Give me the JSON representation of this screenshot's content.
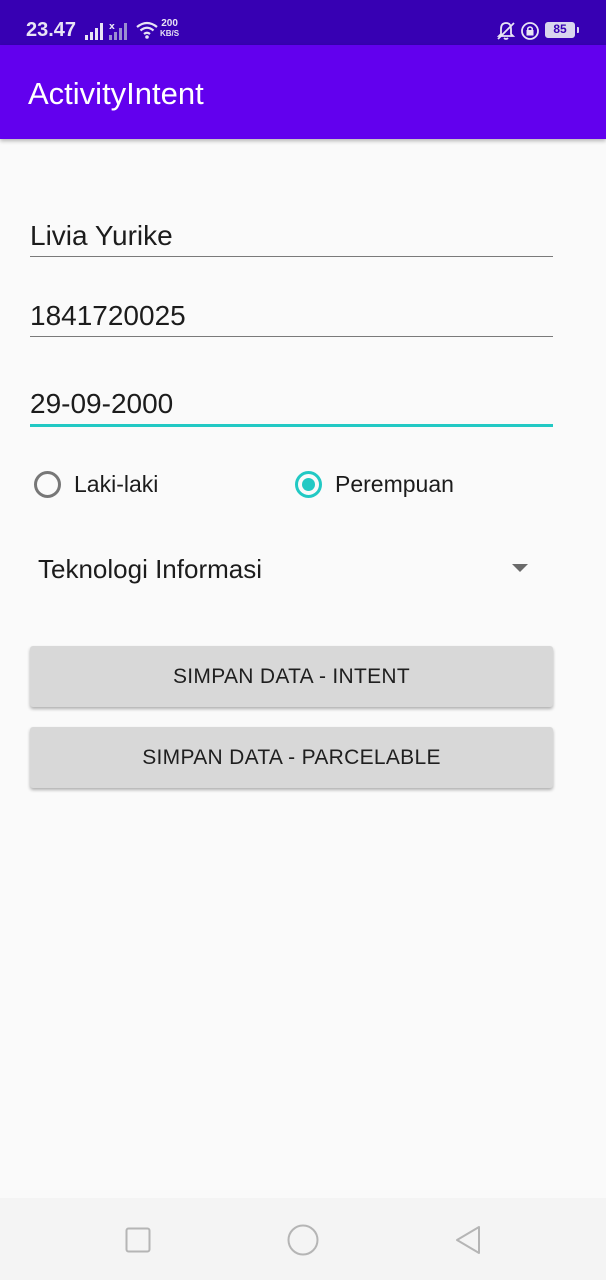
{
  "status_bar": {
    "time": "23.47",
    "net_speed_value": "200",
    "net_speed_unit": "KB/S",
    "battery": "85",
    "icons": [
      "signal-icon",
      "wifi-icon",
      "bell-off-icon",
      "lock-icon",
      "battery-icon"
    ]
  },
  "app_bar": {
    "title": "ActivityIntent"
  },
  "form": {
    "name_value": "Livia Yurike",
    "nim_value": "1841720025",
    "date_value": "29-09-2000",
    "gender_options": [
      {
        "label": "Laki-laki",
        "checked": false
      },
      {
        "label": "Perempuan",
        "checked": true
      }
    ],
    "program_selected": "Teknologi Informasi"
  },
  "buttons": {
    "save_intent": "SIMPAN DATA - INTENT",
    "save_parcelable": "SIMPAN DATA - PARCELABLE"
  },
  "nav_bar": {
    "icons": [
      "recent-apps-icon",
      "home-icon",
      "back-icon"
    ]
  },
  "colors": {
    "status_bar": "#3700b3",
    "app_bar": "#6200ee",
    "accent": "#22c9c4",
    "button": "#d8d8d8",
    "background": "#fafafa"
  }
}
